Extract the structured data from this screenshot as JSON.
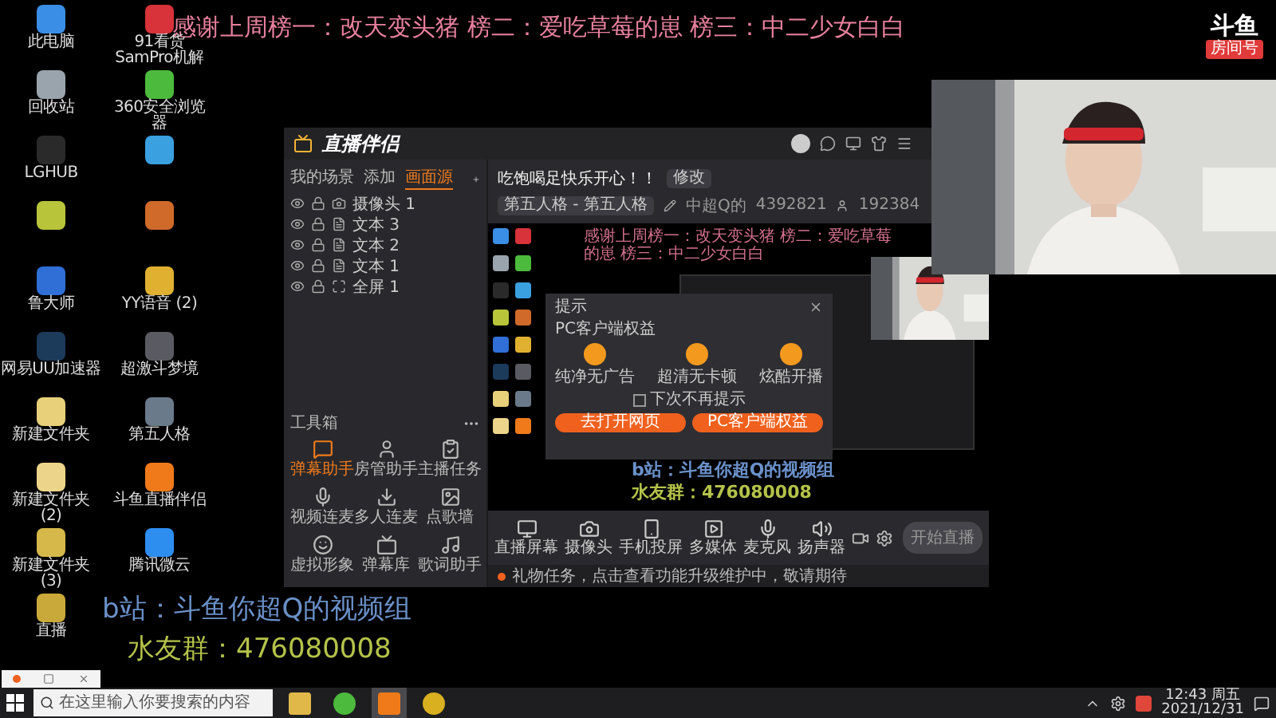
{
  "banner": "感谢上周榜一：改天变头猪 榜二：爱吃草莓的崽 榜三：中二少女白白",
  "logo": {
    "name": "斗鱼",
    "badge": "房间号"
  },
  "desktop_icons": [
    {
      "label": "此电脑",
      "color": "#3a8ee6"
    },
    {
      "label": "91看货 SamPro机解",
      "color": "#d8323a"
    },
    {
      "label": "回收站",
      "color": "#9aa4ad"
    },
    {
      "label": "360安全浏览器",
      "color": "#4cba3c"
    },
    {
      "label": "LGHUB",
      "color": "#2a2a2a"
    },
    {
      "color": "#3aa0e0"
    },
    {
      "color": "#b8c43a"
    },
    {
      "color": "#d06a2a"
    },
    {
      "label": "鲁大师",
      "color": "#2f6fd6"
    },
    {
      "label": "YY语音 (2)",
      "color": "#e0b030"
    },
    {
      "label": "网易UU加速器",
      "color": "#1c3a5a"
    },
    {
      "label": "超激斗梦境",
      "color": "#5a5a62"
    },
    {
      "label": "新建文件夹",
      "color": "#e8cf7a"
    },
    {
      "label": "第五人格",
      "color": "#6a7a8a"
    },
    {
      "label": "新建文件夹 (2)",
      "color": "#ecd58a"
    },
    {
      "label": "斗鱼直播伴侣",
      "color": "#f07a1a"
    },
    {
      "label": "新建文件夹 (3)",
      "color": "#d6b84a"
    },
    {
      "label": "腾讯微云",
      "color": "#2d8ef0"
    },
    {
      "label": "直播",
      "color": "#c9a93a"
    }
  ],
  "app": {
    "title": "直播伴侣",
    "scene_tabs": [
      {
        "label": "我的场景",
        "selected": false
      },
      {
        "label": "添加",
        "selected": false
      },
      {
        "label": "画面源",
        "selected": true
      }
    ],
    "sources": [
      {
        "label": "摄像头 1",
        "kind": "camera"
      },
      {
        "label": "文本 3",
        "kind": "text"
      },
      {
        "label": "文本 2",
        "kind": "text"
      },
      {
        "label": "文本 1",
        "kind": "text"
      },
      {
        "label": "全屏 1",
        "kind": "screen"
      }
    ],
    "toolbox_title": "工具箱",
    "tools": [
      {
        "label": "弹幕助手",
        "selected": true
      },
      {
        "label": "房管助手",
        "selected": false
      },
      {
        "label": "主播任务",
        "selected": false
      },
      {
        "label": "视频连麦",
        "selected": false
      },
      {
        "label": "多人连麦",
        "selected": false
      },
      {
        "label": "点歌墙",
        "selected": false
      },
      {
        "label": "虚拟形象",
        "selected": false
      },
      {
        "label": "弹幕库",
        "selected": false
      },
      {
        "label": "歌词助手",
        "selected": false
      }
    ],
    "room": {
      "title": "吃饱喝足快乐开心！！",
      "edit": "修改",
      "category": "第五人格 - 第五人格",
      "name": "中超Q的",
      "room_id": "4392821",
      "fans": "192384"
    },
    "preview": {
      "banner": "感谢上周榜一：改天变头猪 榜二：爱吃草莓的崽 榜三：中二少女白白",
      "dialog": {
        "title": "提示",
        "subtitle": "PC客户端权益",
        "features": [
          "纯净无广告",
          "超清无卡顿",
          "炫酷开播"
        ],
        "checkbox": {
          "label": "下次不再提示",
          "checked": false
        },
        "buttons": [
          "去打开网页",
          "PC客户端权益"
        ]
      },
      "overlay_lines": [
        {
          "text": "b站：斗鱼你超Q的视频组",
          "color": "#6a90c8"
        },
        {
          "text": "水友群：476080008",
          "color": "#b4c24a"
        }
      ]
    },
    "controls": [
      "直播屏幕",
      "摄像头",
      "手机投屏",
      "多媒体",
      "麦克风",
      "扬声器"
    ],
    "start_button": "开始直播",
    "status": "礼物任务，点击查看功能升级维护中，敬请期待"
  },
  "overlay_lines": [
    {
      "text": "b站：斗鱼你超Q的视频组",
      "color": "#6a90c8"
    },
    {
      "text": "水友群：476080008",
      "color": "#b4c24a"
    }
  ],
  "taskbar": {
    "search_placeholder": "在这里输入你要搜索的内容",
    "time": "12:43 周五",
    "date": "2021/12/31"
  }
}
